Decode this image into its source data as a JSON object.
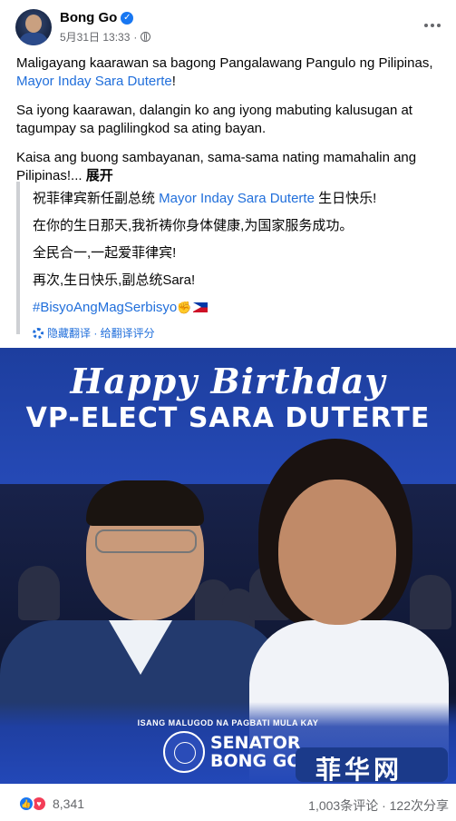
{
  "post": {
    "author": "Bong Go",
    "timestamp": "5月31日 13:33",
    "privacy_icon": "globe-icon",
    "text": {
      "p1_before": "Maligayang kaarawan sa bagong Pangalawang Pangulo ng Pilipinas, ",
      "p1_mention": "Mayor Inday Sara Duterte",
      "p1_after": "!",
      "p2": "Sa iyong kaarawan, dalangin ko ang iyong mabuting kalusugan at tagumpay sa paglilingkod sa ating bayan.",
      "p3": "Kaisa ang buong sambayanan, sama-sama nating mamahalin ang Pilipinas!...",
      "see_more": "展开"
    },
    "translation": {
      "l1_before": "祝菲律宾新任副总统 ",
      "l1_mention": "Mayor Inday Sara Duterte",
      "l1_after": " 生日快乐!",
      "l2": "在你的生日那天,我祈祷你身体健康,为国家服务成功。",
      "l3": "全民合一,一起爱菲律宾!",
      "l4": "再次,生日快乐,副总统Sara!",
      "hashtag": "#BisyoAngMagSerbisyo",
      "actions": "隐藏翻译 · 给翻译评分"
    }
  },
  "photo": {
    "headline": "Happy Birthday",
    "subheadline": "VP-ELECT SARA DUTERTE",
    "greeting": "ISANG MALUGOD NA PAGBATI MULA KAY",
    "senator_line1": "SENATOR",
    "senator_line2": "BONG GO",
    "watermark": "菲华网"
  },
  "footer": {
    "reaction_count": "8,341",
    "comment_share": "1,003条评论 · 122次分享"
  },
  "colors": {
    "accent": "#216fdb",
    "like": "#1877f2",
    "love": "#f33e58",
    "photo_blue": "#2348b8"
  }
}
